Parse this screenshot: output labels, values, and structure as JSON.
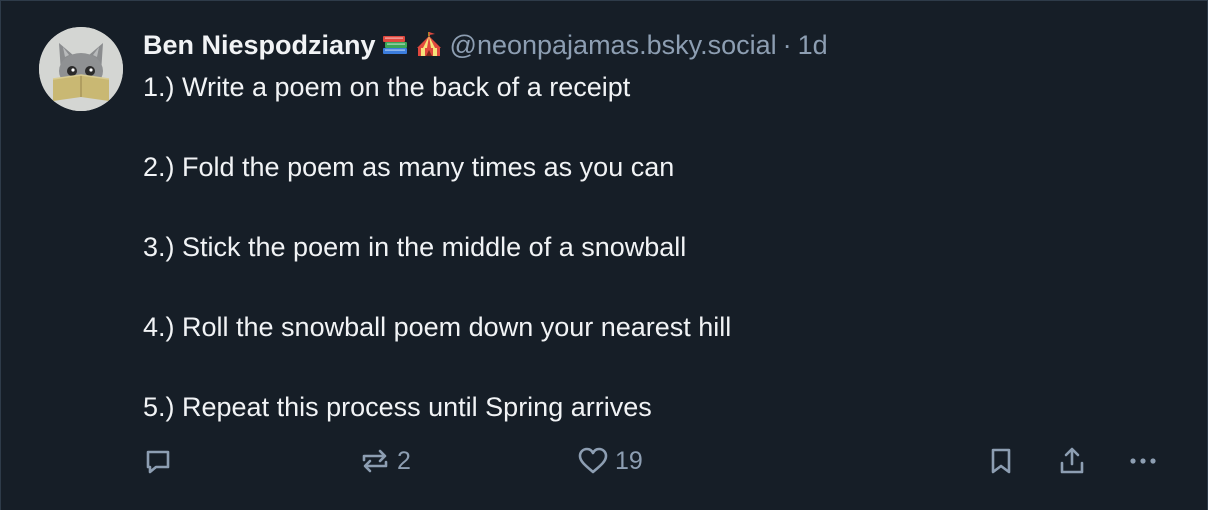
{
  "post": {
    "author": {
      "display_name": "Ben Niespodziany",
      "emoji_icons": [
        "books-icon",
        "circus-tent-icon"
      ],
      "handle": "@neonpajamas.bsky.social",
      "separator": "·",
      "time_ago": "1d"
    },
    "lines": [
      "1.) Write a poem on the back of a receipt",
      "2.) Fold the poem as many times as you can",
      "3.) Stick the poem in the middle of a snowball",
      "4.) Roll the snowball poem down your nearest hill",
      "5.) Repeat this process until Spring arrives"
    ],
    "actions": {
      "reply": {
        "icon": "reply-bubble-icon",
        "count": ""
      },
      "repost": {
        "icon": "repost-icon",
        "count": "2"
      },
      "like": {
        "icon": "heart-icon",
        "count": "19"
      },
      "bookmark": {
        "icon": "bookmark-icon"
      },
      "share": {
        "icon": "share-icon"
      },
      "more": {
        "icon": "more-dots-icon"
      }
    }
  },
  "colors": {
    "background": "#161e27",
    "border": "#2e3b49",
    "text": "#f1f3f5",
    "muted": "#8d9eb2"
  }
}
